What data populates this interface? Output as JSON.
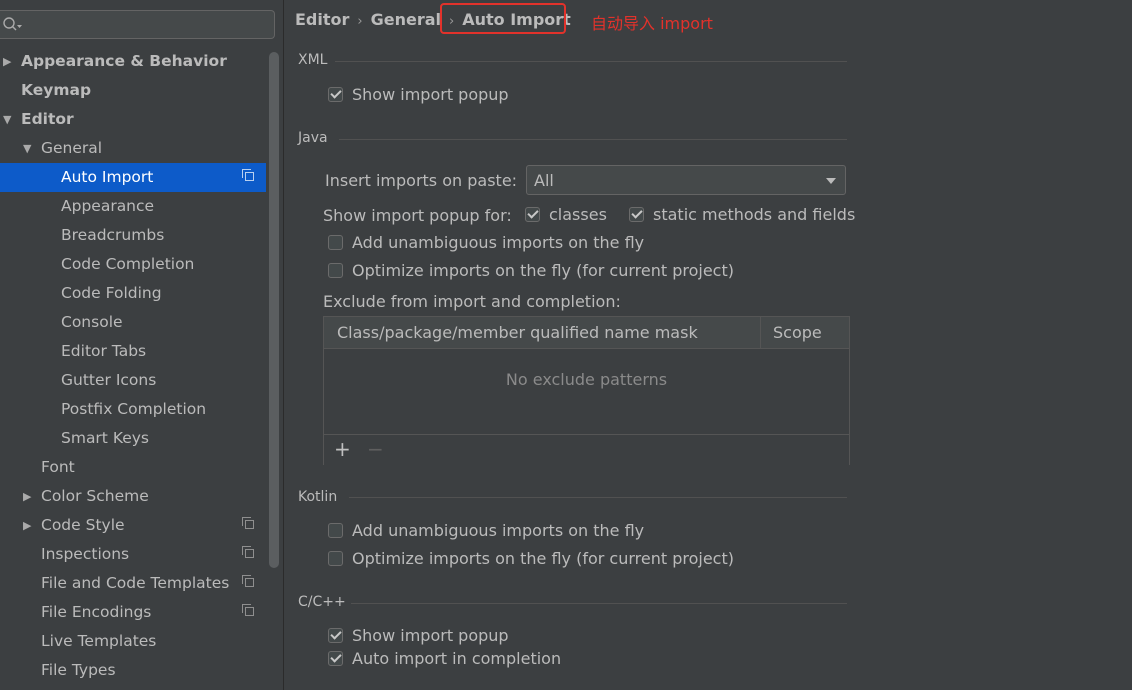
{
  "search": {
    "placeholder": ""
  },
  "sidebar": {
    "items": [
      {
        "label": "Appearance & Behavior",
        "arrow": "▶"
      },
      {
        "label": "Keymap"
      },
      {
        "label": "Editor",
        "arrow": "▼"
      },
      {
        "label": "General",
        "arrow": "▼"
      },
      {
        "label": "Auto Import",
        "selected": true
      },
      {
        "label": "Appearance"
      },
      {
        "label": "Breadcrumbs"
      },
      {
        "label": "Code Completion"
      },
      {
        "label": "Code Folding"
      },
      {
        "label": "Console"
      },
      {
        "label": "Editor Tabs"
      },
      {
        "label": "Gutter Icons"
      },
      {
        "label": "Postfix Completion"
      },
      {
        "label": "Smart Keys"
      },
      {
        "label": "Font"
      },
      {
        "label": "Color Scheme",
        "arrow": "▶"
      },
      {
        "label": "Code Style",
        "arrow": "▶"
      },
      {
        "label": "Inspections"
      },
      {
        "label": "File and Code Templates"
      },
      {
        "label": "File Encodings"
      },
      {
        "label": "Live Templates"
      },
      {
        "label": "File Types"
      }
    ]
  },
  "breadcrumb": {
    "editor": "Editor",
    "general": "General",
    "current": "Auto Import",
    "separator": "›"
  },
  "annotation": "自动导入 import",
  "xml": {
    "title": "XML",
    "show_popup": {
      "label": "Show import popup",
      "checked": true
    }
  },
  "java": {
    "title": "Java",
    "insert_on_paste": {
      "label": "Insert imports on paste:",
      "value": "All"
    },
    "show_popup_for": {
      "label": "Show import popup for:",
      "classes": {
        "label": "classes",
        "checked": true
      },
      "static": {
        "label": "static methods and fields",
        "checked": true
      }
    },
    "add_unambiguous": {
      "label": "Add unambiguous imports on the fly",
      "checked": false
    },
    "optimize": {
      "label": "Optimize imports on the fly (for current project)",
      "checked": false
    },
    "exclude": {
      "label": "Exclude from import and completion:",
      "columns": [
        "Class/package/member qualified name mask",
        "Scope"
      ],
      "empty_text": "No exclude patterns",
      "add": "+",
      "remove": "−"
    }
  },
  "kotlin": {
    "title": "Kotlin",
    "add_unambiguous": {
      "label": "Add unambiguous imports on the fly",
      "checked": false
    },
    "optimize": {
      "label": "Optimize imports on the fly (for current project)",
      "checked": false
    }
  },
  "cpp": {
    "title": "C/C++",
    "show_popup": {
      "label": "Show import popup",
      "checked": true
    },
    "auto_import": {
      "label": "Auto import in completion",
      "checked": true
    }
  },
  "colors": {
    "selection": "#0d5bc9",
    "annotation": "#e2322b",
    "background": "#3c3f41"
  }
}
